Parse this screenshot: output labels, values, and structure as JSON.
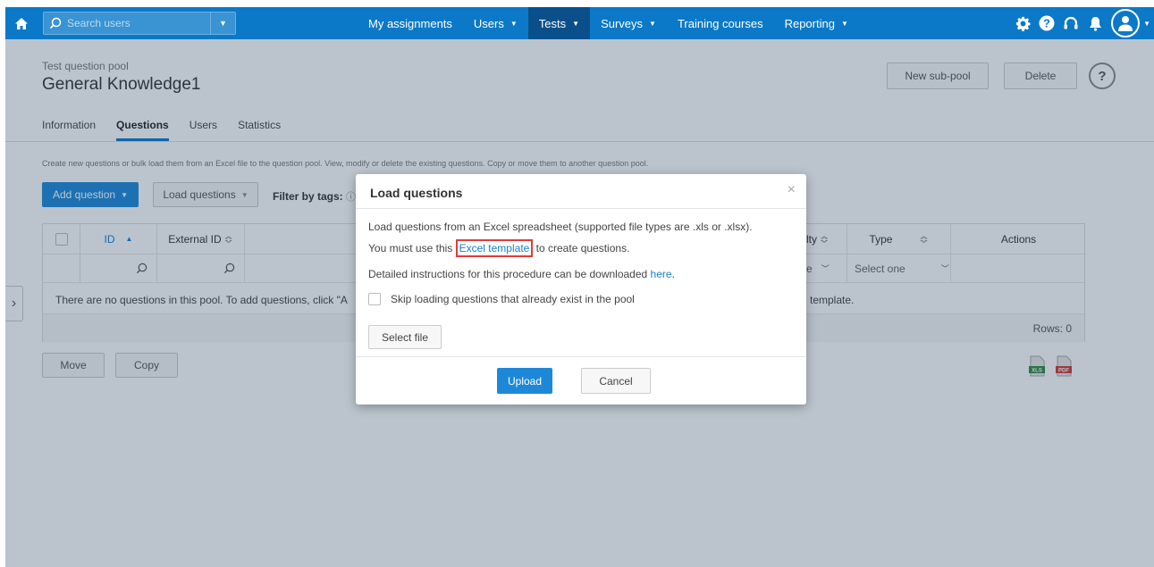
{
  "nav": {
    "search_placeholder": "Search users",
    "items": [
      {
        "label": "My assignments",
        "has_caret": false
      },
      {
        "label": "Users",
        "has_caret": true
      },
      {
        "label": "Tests",
        "has_caret": true,
        "active": true
      },
      {
        "label": "Surveys",
        "has_caret": true
      },
      {
        "label": "Training courses",
        "has_caret": false
      },
      {
        "label": "Reporting",
        "has_caret": true
      }
    ],
    "caret": "▼",
    "icons": [
      "gear-icon",
      "help-icon",
      "headset-icon",
      "bell-icon",
      "user-icon"
    ]
  },
  "header": {
    "breadcrumb": "Test question pool",
    "title": "General Knowledge1",
    "new_subpool_label": "New sub-pool",
    "delete_label": "Delete",
    "help": "?"
  },
  "tabs": [
    "Information",
    "Questions",
    "Users",
    "Statistics"
  ],
  "content": {
    "description": "Create new questions or bulk load them from an Excel file to the question pool. View, modify or delete the existing questions. Copy or move them to another question pool.",
    "add_question_label": "Add question",
    "load_questions_label": "Load questions",
    "filter_label": "Filter by tags:"
  },
  "grid": {
    "col_id": "ID",
    "col_external_id": "External ID",
    "col_difficulty_partial": "lty",
    "col_type": "Type",
    "col_actions": "Actions",
    "filter_partial": "e",
    "type_select": "Select one",
    "no_data_left": "There are no questions in this pool. To add questions, click \"A",
    "no_data_right": "l template.",
    "rows": "Rows: 0"
  },
  "bottom": {
    "move_label": "Move",
    "copy_label": "Copy",
    "xls_label": "XLS",
    "pdf_label": "PDF"
  },
  "modal": {
    "title": "Load questions",
    "close": "×",
    "line1": "Load questions from an Excel spreadsheet (supported file types are .xls or .xlsx).",
    "line2_before": "You must use this",
    "line2_link": "Excel template",
    "line2_after": "to create questions.",
    "line3_before": "Detailed instructions for this procedure can be downloaded",
    "line3_link": "here",
    "line3_after": ".",
    "skip_label": "Skip loading questions that already exist in the pool",
    "select_file_label": "Select file",
    "upload_label": "Upload",
    "cancel_label": "Cancel"
  },
  "colors": {
    "nav_bg": "#0b79c7",
    "nav_active": "#0a4f8a",
    "primary": "#1e88d8",
    "highlight": "#e23a3a"
  }
}
